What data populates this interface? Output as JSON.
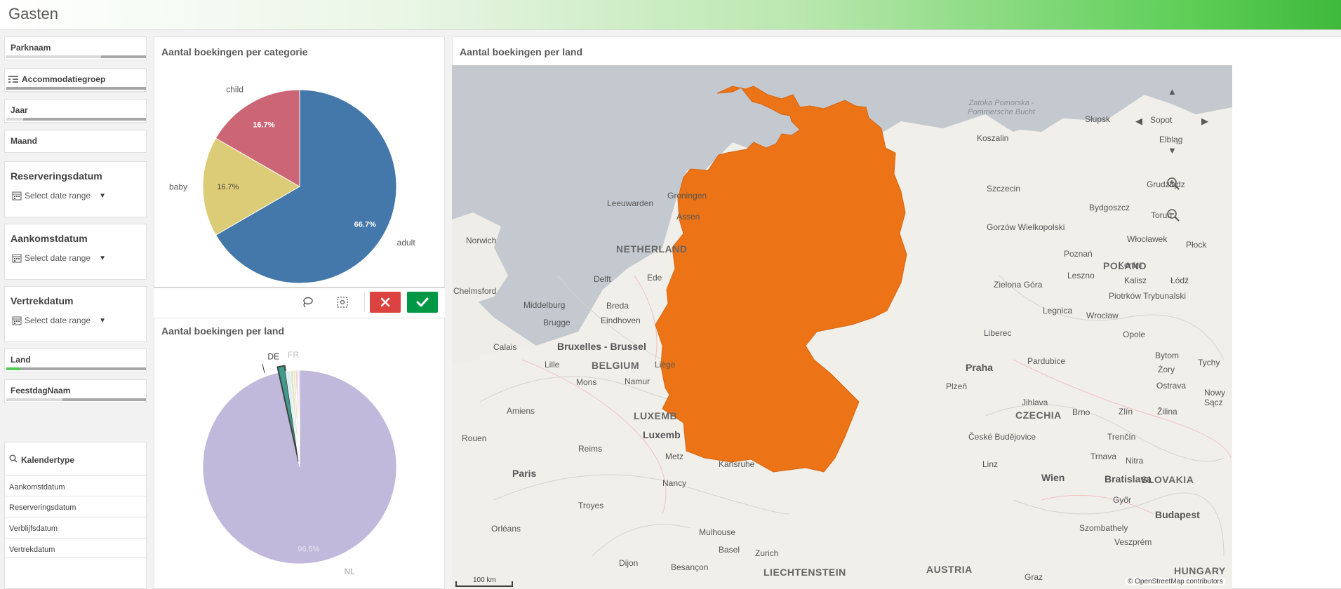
{
  "app": {
    "title": "Gasten"
  },
  "filters": [
    {
      "label": "Parknaam"
    },
    {
      "label": "Accommodatiegroep"
    },
    {
      "label": "Jaar"
    },
    {
      "label": "Maand"
    }
  ],
  "date_filters": [
    {
      "label": "Reserveringsdatum",
      "placeholder": "Select date range"
    },
    {
      "label": "Aankomstdatum",
      "placeholder": "Select date range"
    },
    {
      "label": "Vertrekdatum",
      "placeholder": "Select date range"
    }
  ],
  "filters2": [
    {
      "label": "Land"
    },
    {
      "label": "FeestdagNaam"
    }
  ],
  "kalendertype": {
    "title": "Kalendertype",
    "items": [
      "Aankomstdatum",
      "Reserveringsdatum",
      "Verblijfsdatum",
      "Vertrekdatum"
    ]
  },
  "selection_toolbar": {
    "icons": [
      "lasso-icon",
      "rectangle-select-icon"
    ],
    "cancel_icon": "close-icon",
    "confirm_icon": "checkmark-icon"
  },
  "colors": {
    "accent_green": "#52cc52",
    "cancel_red": "#dc423f",
    "confirm_green": "#009845",
    "germany_fill": "#ec7416"
  },
  "chart_data": [
    {
      "type": "pie",
      "title": "Aantal boekingen per categorie",
      "categories": [
        "adult",
        "baby",
        "child"
      ],
      "values": [
        66.7,
        16.7,
        16.7
      ],
      "data_labels": [
        "66.7%",
        "16.7%",
        "16.7%"
      ],
      "colors": [
        "#4477aa",
        "#ddcc77",
        "#cc6677"
      ]
    },
    {
      "type": "pie",
      "title": "Aantal boekingen per land",
      "categories": [
        "NL",
        "DE",
        "other-1",
        "other-2",
        "other-3",
        "other-4",
        "other-5",
        "FR"
      ],
      "category_labels": [
        "NL",
        "DE",
        "",
        "",
        "",
        "",
        "",
        "FR"
      ],
      "values": [
        96.5,
        1.2,
        0.7,
        0.5,
        0.4,
        0.3,
        0.2,
        0.2
      ],
      "data_labels": [
        "96.5%"
      ],
      "colors": [
        "#c1b9dc",
        "#3d9c8c",
        "#dbeef5",
        "#dfe8c3",
        "#f3e4c2",
        "#e6d6ec",
        "#f5c6c6",
        "#d9c8e3"
      ],
      "selected": "DE"
    }
  ],
  "map": {
    "title": "Aantal boekingen per land",
    "highlighted_country": "Germany",
    "scale_label": "100 km",
    "attribution": "© OpenStreetMap contributors",
    "nav_icons": [
      "pan-up-icon",
      "pan-left-icon",
      "pan-right-icon",
      "pan-down-icon",
      "zoom-in-icon",
      "zoom-out-icon"
    ],
    "country_labels": [
      "NETHERLAND",
      "BELGIUM",
      "LUXEMB",
      "CZECHIA",
      "POLAND",
      "AUSTRIA",
      "LIECHTENSTEIN",
      "SLOVAKIA",
      "HUNGARY"
    ],
    "city_labels": [
      "Leeuwarden",
      "Groningen",
      "Assen",
      "Norwich",
      "Delft",
      "Ede",
      "Chelmsford",
      "Middelburg",
      "Breda",
      "Brugge",
      "Eindhoven",
      "Calais",
      "Bruxelles - Brussel",
      "Lille",
      "Mons",
      "Namur",
      "Liège",
      "Amiens",
      "Rouen",
      "Reims",
      "Metz",
      "Luxemb",
      "Paris",
      "Nancy",
      "Troyes",
      "Orléans",
      "Dijon",
      "Besançon",
      "Mulhouse",
      "Basel",
      "Zurich",
      "Karlsruhe",
      "Słupsk",
      "Koszalin",
      "Elbląg",
      "Sopot",
      "Grudziądz",
      "Bydgoszcz",
      "Toruń",
      "Szczecin",
      "Gorzów Wielkopolski",
      "Włocławek",
      "Płock",
      "Poznań",
      "Konin",
      "Kalisz",
      "Łódź",
      "Leszno",
      "Zielona Góra",
      "Piotrków Trybunalski",
      "Legnica",
      "Wrocław",
      "Liberec",
      "Opole",
      "Bytom",
      "Tychy",
      "Żory",
      "Ostrava",
      "Nowy Sącz",
      "Praha",
      "Pardubice",
      "Plzeň",
      "Jihlava",
      "Brno",
      "Zlín",
      "Žilina",
      "České Budějovice",
      "Trenčín",
      "Trnava",
      "Nitra",
      "Linz",
      "Wien",
      "Bratislava",
      "Győr",
      "Budapest",
      "Szombathely",
      "Veszprém",
      "Graz",
      "Zatoka Pomorska - Pommersche Bucht"
    ]
  }
}
